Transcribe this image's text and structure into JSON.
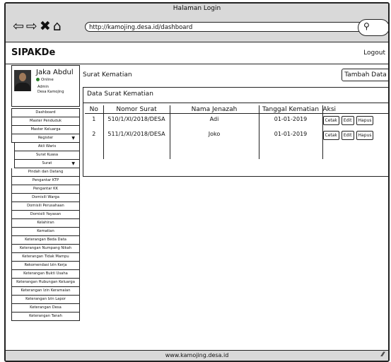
{
  "window": {
    "title": "Halaman Login",
    "url": "http://kamojing.desa.id/dashboard"
  },
  "header": {
    "brand": "SIPAKDe",
    "logout": "Logout"
  },
  "user": {
    "name": "Jaka Abdul",
    "status": "Online",
    "role": "Admin",
    "org": "Desa Kamojing"
  },
  "sidebar": {
    "items": [
      {
        "label": "Dashboard"
      },
      {
        "label": "Master Penduduk"
      },
      {
        "label": "Master Keluarga"
      },
      {
        "label": "Register",
        "caret": "▼"
      },
      {
        "label": "Akli Waris",
        "sub": true
      },
      {
        "label": "Surat Kuasa",
        "sub": true
      },
      {
        "label": "Surat",
        "caret": "▼",
        "sub": true
      },
      {
        "label": "Pindah dan Datang"
      },
      {
        "label": "Pengantar KTP"
      },
      {
        "label": "Pengantar KK"
      },
      {
        "label": "Domisili Warga"
      },
      {
        "label": "Domisili Perusahaan"
      },
      {
        "label": "Domisili Yayasan"
      },
      {
        "label": "Kelahiran"
      },
      {
        "label": "Kematian"
      },
      {
        "label": "Keterangan Beda Data"
      },
      {
        "label": "Keterangan Numpang Nikah"
      },
      {
        "label": "Keterangan Tidak Mampu"
      },
      {
        "label": "Rekomendasi Izin Kerja"
      },
      {
        "label": "Keterangan Bukti Usaha"
      },
      {
        "label": "Keterangan Hubungan Keluarga"
      },
      {
        "label": "Keterangan Izin Keramaian"
      },
      {
        "label": "Keterangan Izin Lapor"
      },
      {
        "label": "Keterangan Desa"
      },
      {
        "label": "Keterangan Tanah"
      }
    ]
  },
  "main": {
    "title": "Surat Kematian",
    "add_button": "Tambah Data",
    "card_title": "Data Surat Kematian",
    "table": {
      "headers": [
        "No",
        "Nomor Surat",
        "Nama Jenazah",
        "Tanggal Kematian",
        "Aksi"
      ],
      "rows": [
        {
          "no": "1",
          "nomor": "510/1/XI/2018/DESA",
          "nama": "Adi",
          "tanggal": "01-01-2019"
        },
        {
          "no": "2",
          "nomor": "511/1/XI/2018/DESA",
          "nama": "Joko",
          "tanggal": "01-01-2019"
        }
      ],
      "actions": [
        "Cetak",
        "Edit",
        "Hapus"
      ]
    }
  },
  "footer": {
    "text": "www.kamojing.desa.id"
  },
  "icons": {
    "back": "back-arrow-icon",
    "forward": "forward-arrow-icon",
    "close": "close-icon",
    "home": "home-icon",
    "search": "search-icon",
    "resize": "resize-grip-icon"
  }
}
